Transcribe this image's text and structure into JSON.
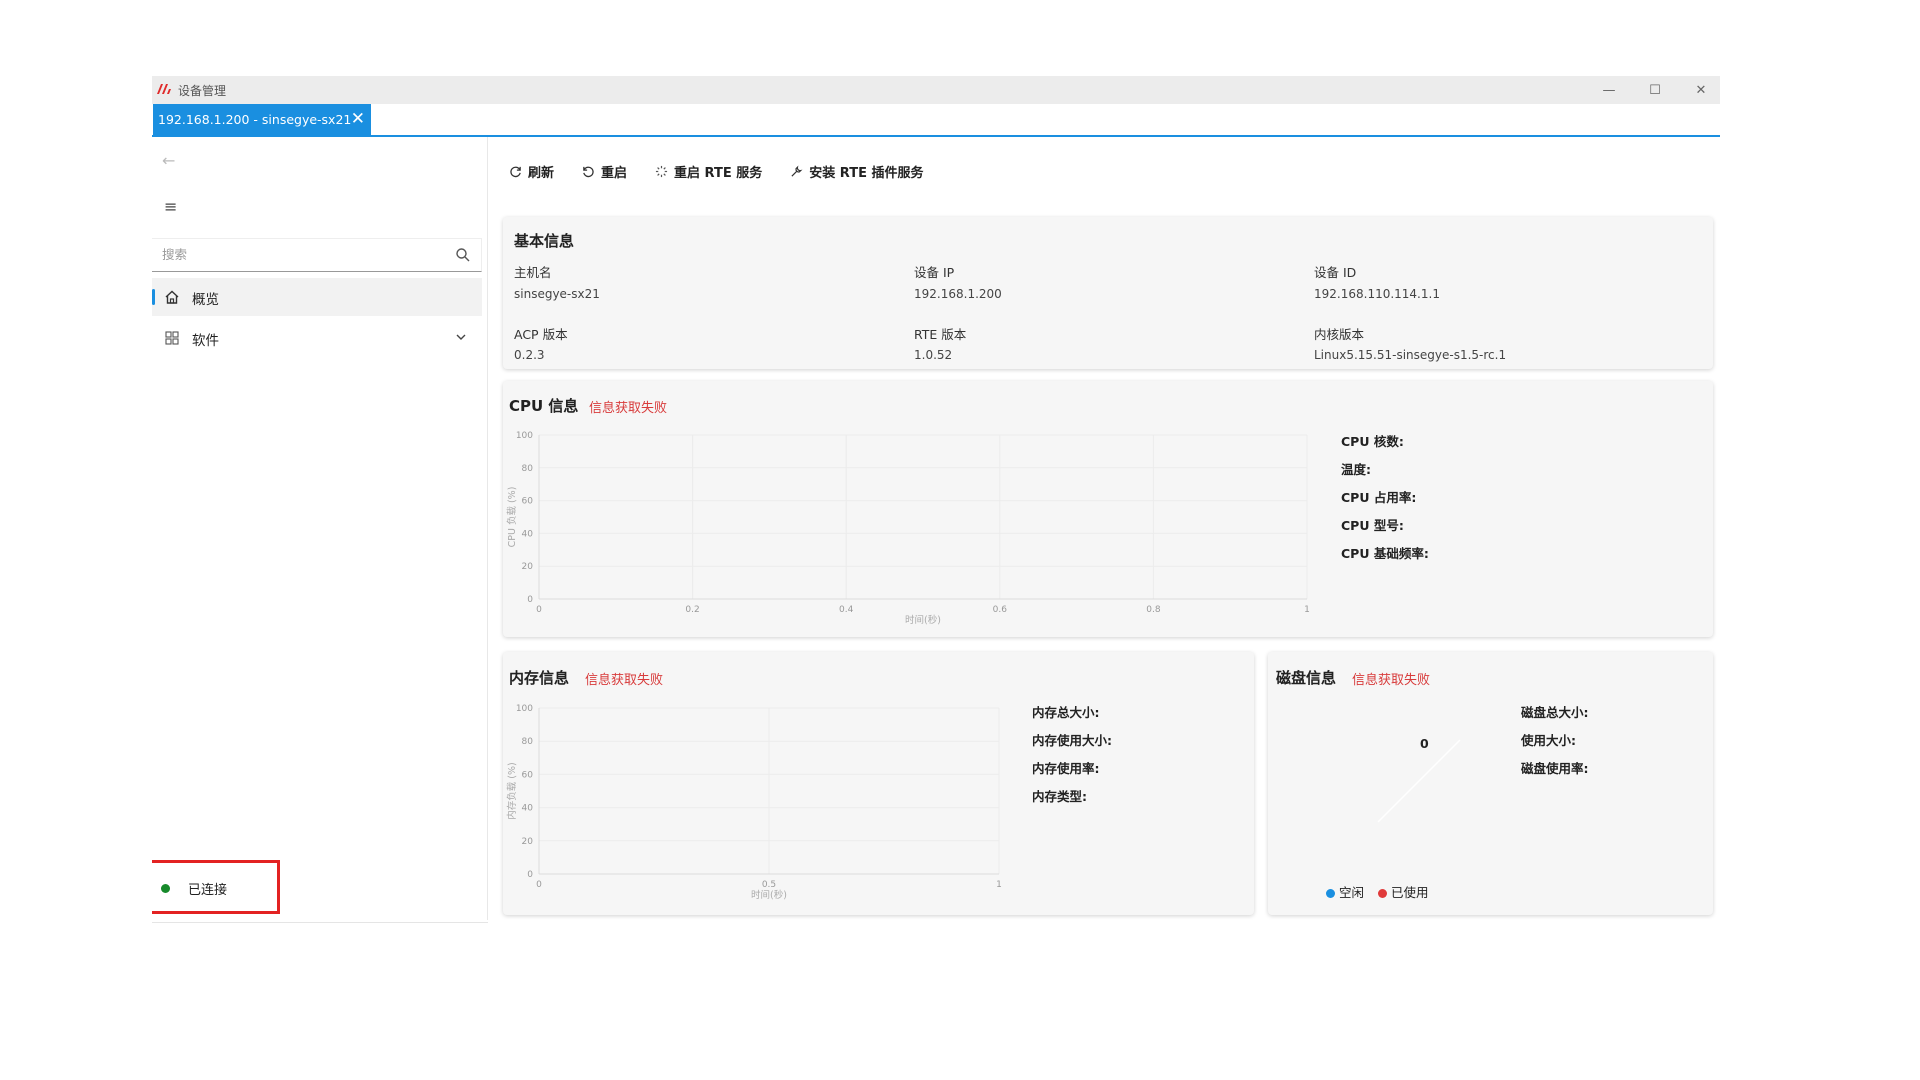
{
  "titlebar": {
    "title": "设备管理",
    "minimize_glyph": "—",
    "maximize_glyph": "☐",
    "close_glyph": "✕"
  },
  "tab": {
    "label": "192.168.1.200 - sinsegye-sx21",
    "close_glyph": "✕"
  },
  "sidebar": {
    "back_glyph": "←",
    "menu_glyph": "≡",
    "search": {
      "placeholder": "搜索",
      "value": ""
    },
    "items": [
      {
        "label": "概览",
        "icon": "home-icon",
        "active": true
      },
      {
        "label": "软件",
        "icon": "grid-icon",
        "expandable": true
      }
    ],
    "status": {
      "label": "已连接",
      "color": "#178a2b"
    }
  },
  "toolbar": {
    "refresh": "刷新",
    "restart": "重启",
    "restart_rte": "重启 RTE 服务",
    "install_rte": "安装 RTE 插件服务"
  },
  "basic_info": {
    "title": "基本信息",
    "fields": [
      {
        "label": "主机名",
        "value": "sinsegye-sx21"
      },
      {
        "label": "设备 IP",
        "value": "192.168.1.200"
      },
      {
        "label": "设备 ID",
        "value": "192.168.110.114.1.1"
      },
      {
        "label": "ACP 版本",
        "value": "0.2.3"
      },
      {
        "label": "RTE 版本",
        "value": "1.0.52"
      },
      {
        "label": "内核版本",
        "value": "Linux5.15.51-sinsegye-s1.5-rc.1"
      }
    ]
  },
  "cpu": {
    "title": "CPU 信息",
    "error": "信息获取失败",
    "stats": [
      "CPU 核数:",
      "温度:",
      "CPU 占用率:",
      "CPU 型号:",
      "CPU 基础频率:"
    ]
  },
  "memory": {
    "title": "内存信息",
    "error": "信息获取失败",
    "stats": [
      "内存总大小:",
      "内存使用大小:",
      "内存使用率:",
      "内存类型:"
    ]
  },
  "disk": {
    "title": "磁盘信息",
    "error": "信息获取失败",
    "stats": [
      "磁盘总大小:",
      "使用大小:",
      "磁盘使用率:"
    ],
    "center_value": "0",
    "legend": [
      {
        "label": "空闲",
        "color": "#1a8fe0"
      },
      {
        "label": "已使用",
        "color": "#e03a3a"
      }
    ]
  },
  "chart_data": [
    {
      "type": "line",
      "ylabel": "CPU 负载 (%)",
      "xlabel": "时间(秒)",
      "ylim": [
        0,
        100
      ],
      "xlim": [
        0,
        1
      ],
      "y_ticks": [
        "100",
        "80",
        "60",
        "40",
        "20",
        "0"
      ],
      "x_ticks": [
        "0",
        "0.2",
        "0.4",
        "0.6",
        "0.8",
        "1"
      ],
      "series": [],
      "grid": true
    },
    {
      "type": "line",
      "ylabel": "内存负载 (%)",
      "xlabel": "时间(秒)",
      "ylim": [
        0,
        100
      ],
      "xlim": [
        0,
        1
      ],
      "y_ticks": [
        "100",
        "80",
        "60",
        "40",
        "20",
        "0"
      ],
      "x_ticks": [
        "0",
        "0.5",
        "1"
      ],
      "series": [],
      "grid": true
    },
    {
      "type": "pie",
      "categories": [
        "空闲",
        "已使用"
      ],
      "values": [
        0,
        0
      ]
    }
  ]
}
